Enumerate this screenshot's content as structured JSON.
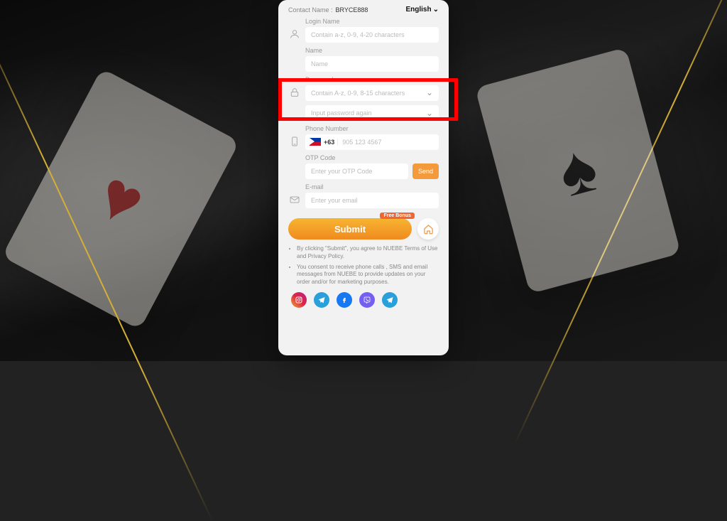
{
  "header": {
    "contact_label": "Contact Name :",
    "contact_value": "BRYCE888",
    "language": "English"
  },
  "fields": {
    "login_name": {
      "label": "Login Name",
      "placeholder": "Contain a-z, 0-9, 4-20 characters"
    },
    "name": {
      "label": "Name",
      "placeholder": "Name"
    },
    "password": {
      "label": "Password",
      "placeholder": "Contain A-z, 0-9, 8-15 characters"
    },
    "confirm": {
      "placeholder": "Input password again"
    },
    "phone": {
      "label": "Phone Number",
      "country_code": "+63",
      "placeholder": "905 123 4567"
    },
    "otp": {
      "label": "OTP Code",
      "placeholder": "Enter your OTP Code",
      "send": "Send"
    },
    "email": {
      "label": "E-mail",
      "placeholder": "Enter your email"
    }
  },
  "submit": {
    "label": "Submit",
    "badge": "Free Bonus"
  },
  "terms": [
    "By clicking \"Submit\", you agree to NUEBE Terms of Use and Privacy Policy.",
    "You consent to receive phone calls , SMS and email messages from NUEBE to provide updates on your order and/or for marketing purposes."
  ]
}
